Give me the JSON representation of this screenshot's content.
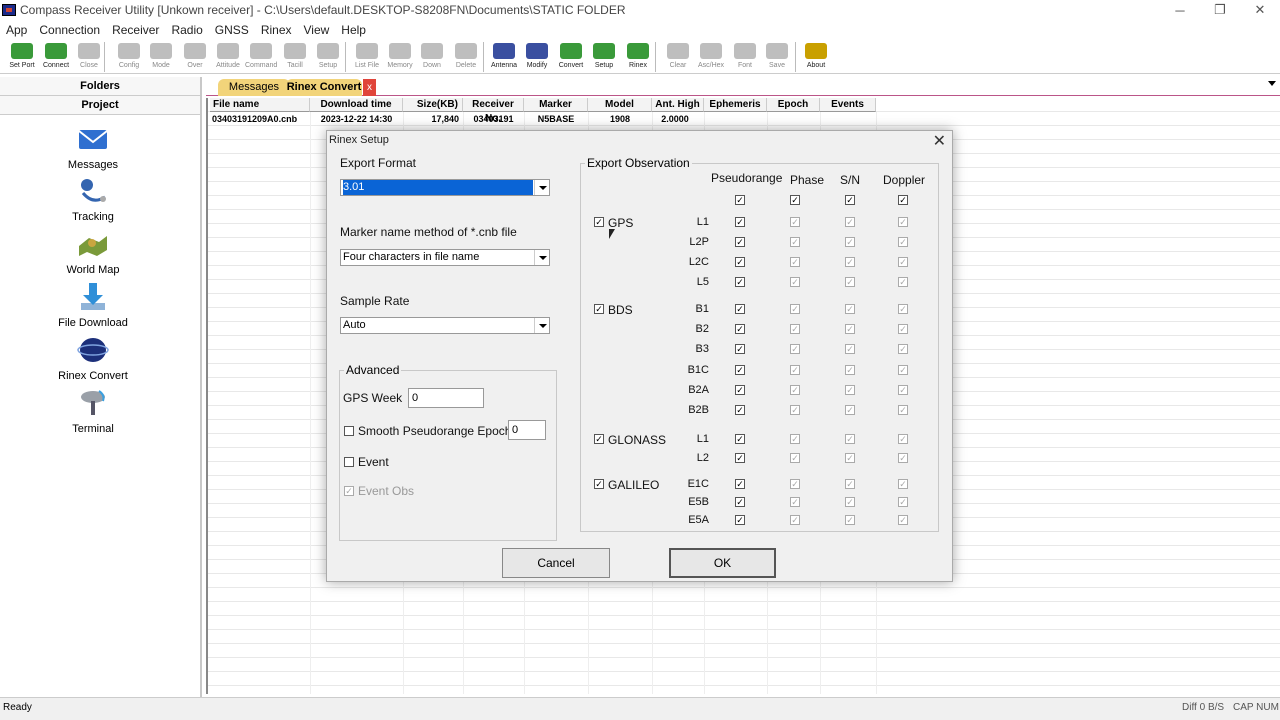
{
  "window": {
    "title": "Compass Receiver Utility [Unkown receiver] - C:\\Users\\default.DESKTOP-S8208FN\\Documents\\STATIC FOLDER"
  },
  "menu": [
    "App",
    "Connection",
    "Receiver",
    "Radio",
    "GNSS",
    "Rinex",
    "View",
    "Help"
  ],
  "toolbar": [
    {
      "label": "Set Port",
      "icon": "set-port-icon"
    },
    {
      "label": "Connect",
      "icon": "connect-icon"
    },
    {
      "label": "Close",
      "icon": "close-port-icon"
    },
    {
      "label": "Config",
      "icon": "config-icon"
    },
    {
      "label": "Mode",
      "icon": "mode-icon"
    },
    {
      "label": "Over",
      "icon": "over-icon"
    },
    {
      "label": "Attitude",
      "icon": "attitude-icon"
    },
    {
      "label": "Command",
      "icon": "command-icon"
    },
    {
      "label": "Tacill",
      "icon": "tacill-icon"
    },
    {
      "label": "Setup",
      "icon": "setup-icon"
    },
    {
      "label": "List File",
      "icon": "list-file-icon"
    },
    {
      "label": "Memory",
      "icon": "memory-icon"
    },
    {
      "label": "Down",
      "icon": "down-icon"
    },
    {
      "label": "Delete",
      "icon": "delete-icon"
    },
    {
      "label": "Antenna",
      "icon": "antenna-icon"
    },
    {
      "label": "Modify",
      "icon": "modify-icon"
    },
    {
      "label": "Convert",
      "icon": "convert-icon"
    },
    {
      "label": "Setup",
      "icon": "rinex-setup-icon"
    },
    {
      "label": "Rinex",
      "icon": "rinex-icon"
    },
    {
      "label": "Clear",
      "icon": "clear-icon"
    },
    {
      "label": "Asc/Hex",
      "icon": "aschex-icon"
    },
    {
      "label": "Font",
      "icon": "font-icon"
    },
    {
      "label": "Save",
      "icon": "save-icon"
    },
    {
      "label": "About",
      "icon": "about-icon"
    }
  ],
  "left": {
    "folders": "Folders",
    "project": "Project",
    "items": [
      {
        "label": "Messages"
      },
      {
        "label": "Tracking"
      },
      {
        "label": "World Map"
      },
      {
        "label": "File Download"
      },
      {
        "label": "Rinex Convert"
      },
      {
        "label": "Terminal"
      }
    ]
  },
  "tabs": {
    "messages": "Messages",
    "rinex": "Rinex Convert",
    "close": "x"
  },
  "table": {
    "headers": [
      "File name",
      "Download time",
      "Size(KB)",
      "Receiver No.",
      "Marker",
      "Model",
      "Ant. High",
      "Ephemeris",
      "Epoch",
      "Events"
    ],
    "rows": [
      [
        "03403191209A0.cnb",
        "2023-12-22 14:30",
        "17,840",
        "03403191",
        "N5BASE",
        "1908",
        "2.0000",
        "",
        "",
        ""
      ]
    ]
  },
  "status": {
    "left": "Ready",
    "right1": "Diff 0 B/S",
    "right2": "CAP NUM"
  },
  "dialog": {
    "title": "Rinex Setup",
    "export_format_label": "Export Format",
    "export_format_value": "3.01",
    "marker_label": "Marker name method of *.cnb file",
    "marker_value": "Four characters in file name",
    "sample_label": "Sample Rate",
    "sample_value": "Auto",
    "advanced": "Advanced",
    "gps_week_label": "GPS Week",
    "gps_week_value": "0",
    "smooth_label": "Smooth Pseudorange Epoch",
    "smooth_value": "0",
    "event_label": "Event",
    "event_obs_label": "Event Obs",
    "obs_title": "Export Observation",
    "cols": [
      "Pseudorange",
      "Phase",
      "S/N",
      "Doppler"
    ],
    "systems": [
      {
        "name": "GPS",
        "signals": [
          "L1",
          "L2P",
          "L2C",
          "L5"
        ]
      },
      {
        "name": "BDS",
        "signals": [
          "B1",
          "B2",
          "B3",
          "B1C",
          "B2A",
          "B2B"
        ]
      },
      {
        "name": "GLONASS",
        "signals": [
          "L1",
          "L2"
        ]
      },
      {
        "name": "GALILEO",
        "signals": [
          "E1C",
          "E5B",
          "E5A"
        ]
      }
    ],
    "cancel": "Cancel",
    "ok": "OK"
  }
}
